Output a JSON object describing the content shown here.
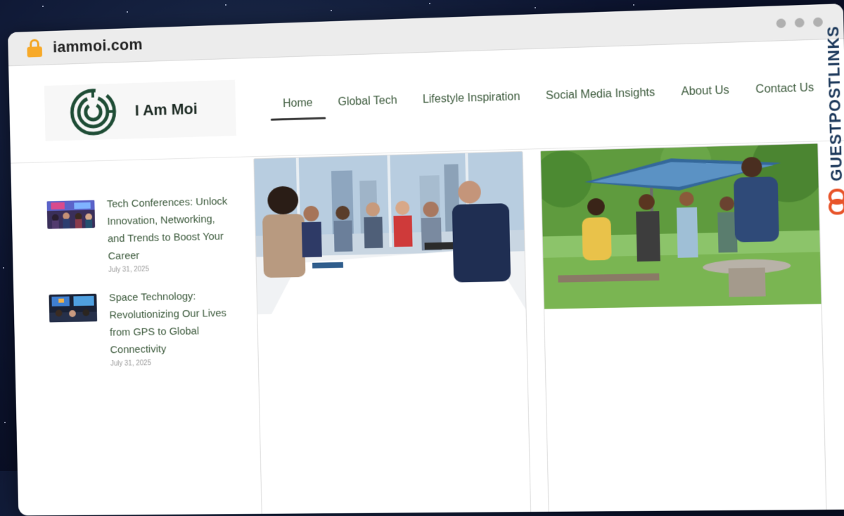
{
  "browser": {
    "url": "iammoi.com"
  },
  "site": {
    "name": "I Am Moi",
    "nav": [
      {
        "label": "Home",
        "active": true
      },
      {
        "label": "Global Tech",
        "active": false
      },
      {
        "label": "Lifestyle Inspiration",
        "active": false
      },
      {
        "label": "Social Media Insights",
        "active": false
      },
      {
        "label": "About Us",
        "active": false
      },
      {
        "label": "Contact Us",
        "active": false
      }
    ],
    "sidebar_posts": [
      {
        "title": "Tech Conferences: Unlock Innovation, Networking, and Trends to Boost Your Career",
        "date": "July 31, 2025"
      },
      {
        "title": "Space Technology: Revolutionizing Our Lives from GPS to Global Connectivity",
        "date": "July 31, 2025"
      }
    ],
    "accent_color": "#3c5a3c"
  },
  "watermark": {
    "text": "GUESTPOSTLINKS"
  }
}
